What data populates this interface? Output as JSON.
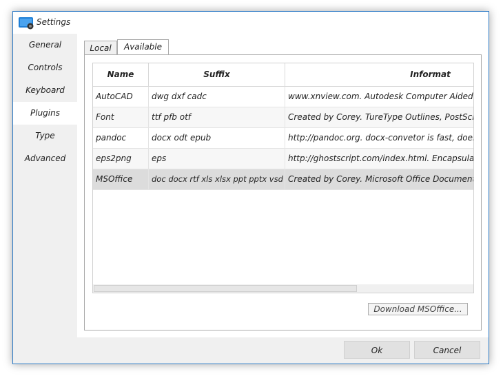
{
  "window": {
    "title": "Settings"
  },
  "sidebar": {
    "items": [
      {
        "label": "General"
      },
      {
        "label": "Controls"
      },
      {
        "label": "Keyboard"
      },
      {
        "label": "Plugins"
      },
      {
        "label": "Type"
      },
      {
        "label": "Advanced"
      }
    ]
  },
  "tabs": [
    {
      "label": "Local"
    },
    {
      "label": "Available"
    }
  ],
  "table": {
    "columns": [
      "Name",
      "Suffix",
      "Informat"
    ],
    "rows": [
      {
        "name": "AutoCAD",
        "suffix": "dwg dxf cadc",
        "info": "www.xnview.com. Autodesk Computer Aided Design"
      },
      {
        "name": "Font",
        "suffix": "ttf pfb otf",
        "info": "Created by Corey. TureType Outlines, PostScript Outlines"
      },
      {
        "name": "pandoc",
        "suffix": "docx odt epub",
        "info": "http://pandoc.org. docx-convetor is fast, does't require"
      },
      {
        "name": "eps2png",
        "suffix": "eps",
        "info": "http://ghostscript.com/index.html. Encapsulated PostScript"
      },
      {
        "name": "MSOffice",
        "suffix": "doc docx rtf xls xlsx ppt pptx vsd vsdx",
        "info": "Created by Corey. Microsoft Office Document (Requires"
      }
    ]
  },
  "download_label": "Download MSOffice...",
  "footer": {
    "ok_label": "Ok",
    "cancel_label": "Cancel"
  }
}
